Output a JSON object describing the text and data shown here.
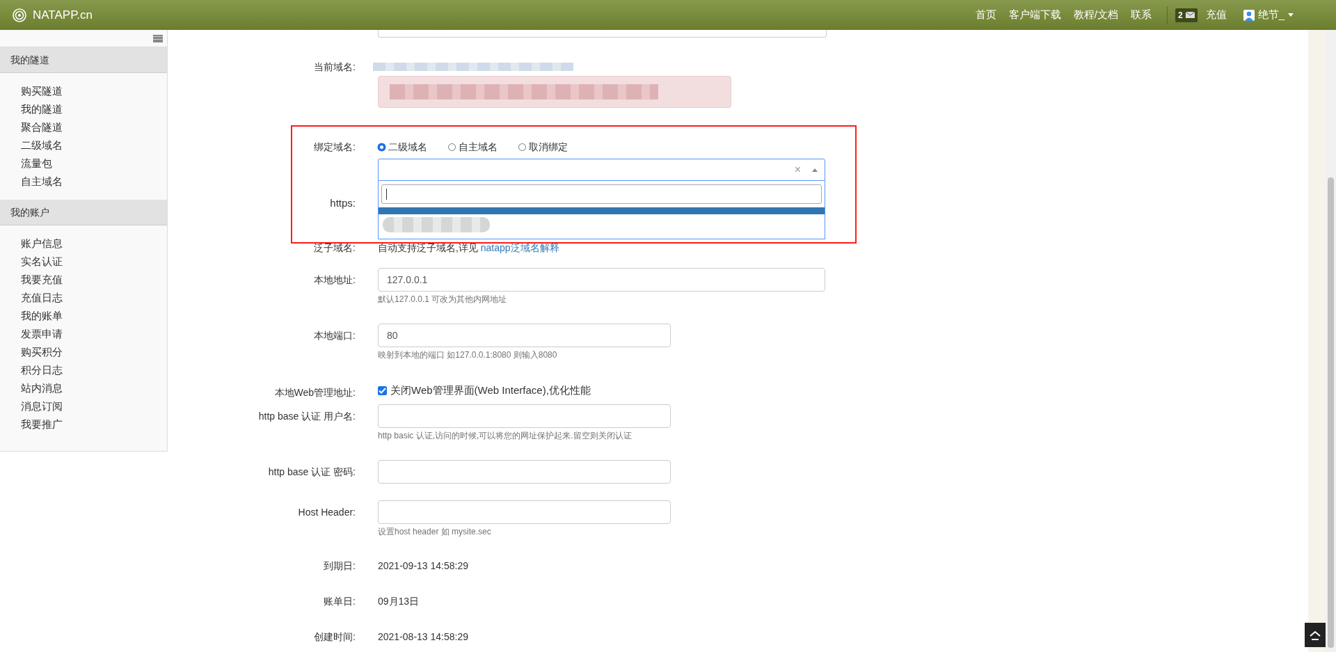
{
  "header": {
    "logo_text": "NATAPP.cn",
    "nav": [
      "首页",
      "客户端下载",
      "教程/文档",
      "联系"
    ],
    "message_count": "2",
    "recharge": "充值",
    "user": "绝节_"
  },
  "sidebar": {
    "sections": [
      {
        "title": "我的隧道",
        "items": [
          "购买隧道",
          "我的隧道",
          "聚合隧道",
          "二级域名",
          "流量包",
          "自主域名"
        ]
      },
      {
        "title": "我的账户",
        "items": [
          "账户信息",
          "实名认证",
          "我要充值",
          "充值日志",
          "我的账单",
          "发票申请",
          "购买积分",
          "积分日志",
          "站内消息",
          "消息订阅",
          "我要推广"
        ]
      }
    ]
  },
  "form": {
    "current_domain_label": "当前域名:",
    "bind_domain": {
      "label": "绑定域名:",
      "options": [
        {
          "label": "二级域名",
          "selected": true
        },
        {
          "label": "自主域名",
          "selected": false
        },
        {
          "label": "取消绑定",
          "selected": false
        }
      ]
    },
    "select": {
      "clear": "×",
      "expanded": true
    },
    "https_label": "https:",
    "wildcard": {
      "label": "泛子域名:",
      "text": "自动支持泛子域名,详见",
      "link": "natapp泛域名解释"
    },
    "local_address": {
      "label": "本地地址:",
      "value": "127.0.0.1",
      "help": "默认127.0.0.1 可改为其他内网地址"
    },
    "local_port": {
      "label": "本地端口:",
      "value": "80",
      "help": "映射到本地的端口 如127.0.0.1:8080 则输入8080"
    },
    "web_admin": {
      "label": "本地Web管理地址:",
      "option": "关闭Web管理界面(Web Interface),优化性能",
      "checked": true
    },
    "auth_user": {
      "label": "http base 认证 用户名:",
      "help": "http basic 认证,访问的时候,可以将您的网址保护起来.留空则关闭认证"
    },
    "auth_password": {
      "label": "http base 认证 密码:"
    },
    "host_header": {
      "label": "Host Header:",
      "help": "设置host header 如 mysite.sec"
    },
    "info": [
      {
        "label": "到期日:",
        "value": "2021-09-13 14:58:29"
      },
      {
        "label": "账单日:",
        "value": "09月13日"
      },
      {
        "label": "创建时间:",
        "value": "2021-08-13 14:58:29"
      }
    ]
  }
}
